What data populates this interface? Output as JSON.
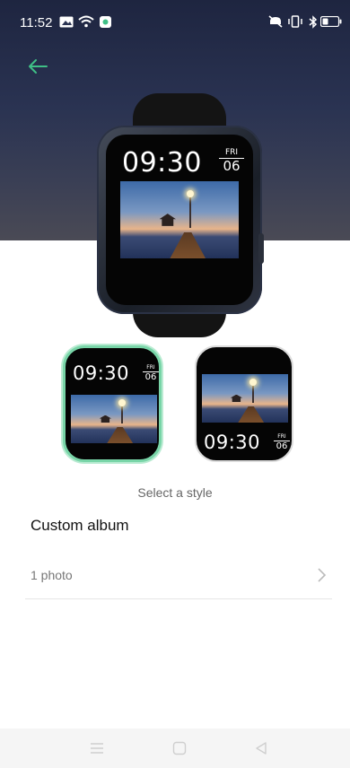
{
  "status": {
    "time": "11:52",
    "left_icons": [
      "image-icon",
      "wifi-icon",
      "app-notification-icon"
    ],
    "right_icons": [
      "mute-icon",
      "vibrate-icon",
      "bluetooth-icon",
      "battery-icon"
    ]
  },
  "header": {
    "back_icon": "arrow-left-icon",
    "accent_color": "#3fbf86"
  },
  "preview": {
    "time": "09:30",
    "day": "FRI",
    "date": "06"
  },
  "styles": [
    {
      "time": "09:30",
      "day": "FRI",
      "date": "06",
      "selected": true,
      "layout": "time-top"
    },
    {
      "time": "09:30",
      "day": "FRI",
      "date": "06",
      "selected": false,
      "layout": "time-bottom"
    }
  ],
  "select_label": "Select a style",
  "section": {
    "title": "Custom album",
    "row_label": "1 photo",
    "row_icon": "chevron-right-icon"
  },
  "navbar": {
    "icons": [
      "menu-icon",
      "home-icon",
      "back-triangle-icon"
    ]
  }
}
